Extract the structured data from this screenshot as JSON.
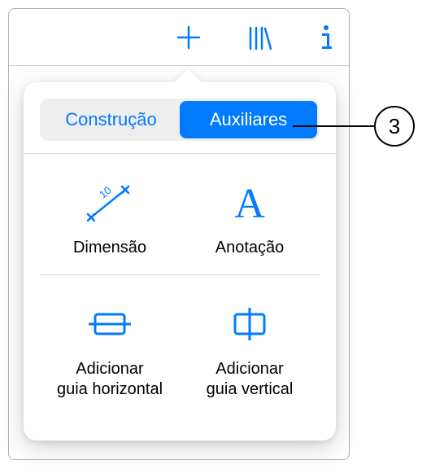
{
  "toolbar": {
    "add_icon": "plus",
    "library_icon": "books",
    "info_icon": "info"
  },
  "segmented": {
    "inactive": "Construção",
    "active": "Auxiliares"
  },
  "tools": {
    "dimension": {
      "label": "Dimensão"
    },
    "annotation": {
      "label": "Anotação"
    },
    "guide_h": {
      "label": "Adicionar\nguia horizontal"
    },
    "guide_v": {
      "label": "Adicionar\nguia vertical"
    }
  },
  "callout": {
    "number": "3"
  },
  "colors": {
    "accent": "#007AFF"
  }
}
